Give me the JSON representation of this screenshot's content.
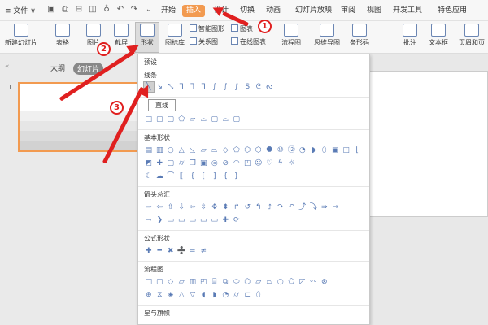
{
  "topbar": {
    "file_menu": "≡ 文件 ∨",
    "tabs": [
      "开始",
      "插入",
      "设计",
      "切换",
      "动画",
      "幻灯片放映",
      "审阅",
      "视图",
      "开发工具",
      "特色应用"
    ],
    "active_tab": "插入"
  },
  "ribbon": {
    "new_slide": "新建幻灯片",
    "table": "表格",
    "picture": "图片",
    "screenshot": "截屏",
    "shape": "形状",
    "icon_lib": "图标库",
    "smart_art": "智能图形",
    "chart": "图表",
    "relation": "关系图",
    "online_chart": "在线图表",
    "flowchart": "流程图",
    "mindmap": "思维导图",
    "bar_chart": "条形码",
    "comment": "批注",
    "textbox": "文本框",
    "header_footer": "页眉和页"
  },
  "left_panel": {
    "collapse": "«",
    "tab_outline": "大纲",
    "tab_slides": "幻灯片",
    "slide_number": "1"
  },
  "dropdown": {
    "preset": "预设",
    "section_lines": "线条",
    "section_basic": "基本形状",
    "section_arrows": "箭头总汇",
    "section_formula": "公式形状",
    "section_flow": "流程图",
    "section_stars": "星与旗帜",
    "tooltip": "直线"
  },
  "annotations": {
    "badge1": "1",
    "badge2": "2",
    "badge3": "3",
    "color": "#e02020"
  }
}
